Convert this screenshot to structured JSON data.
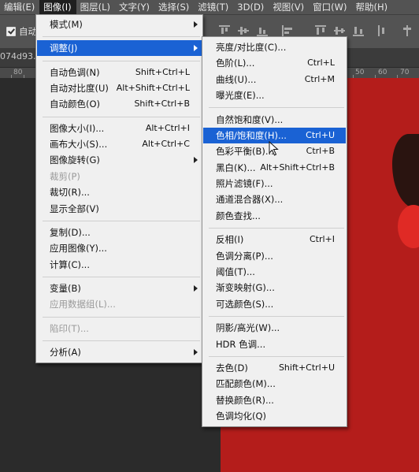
{
  "menubar": [
    {
      "label": "编辑(E)"
    },
    {
      "label": "图像(I)",
      "active": true
    },
    {
      "label": "图层(L)"
    },
    {
      "label": "文字(Y)"
    },
    {
      "label": "选择(S)"
    },
    {
      "label": "滤镜(T)"
    },
    {
      "label": "3D(D)"
    },
    {
      "label": "视图(V)"
    },
    {
      "label": "窗口(W)"
    },
    {
      "label": "帮助(H)"
    }
  ],
  "options_bar": {
    "auto_select_label": "自动"
  },
  "document_tab": {
    "title": "074d93.j"
  },
  "ruler": {
    "labels": [
      "80",
      "50",
      "60",
      "70"
    ]
  },
  "image_menu": [
    {
      "label": "模式(M)",
      "submenu": true
    },
    {
      "sep": true
    },
    {
      "label": "调整(J)",
      "submenu": true,
      "highlight": true
    },
    {
      "sep": true
    },
    {
      "label": "自动色调(N)",
      "shortcut": "Shift+Ctrl+L"
    },
    {
      "label": "自动对比度(U)",
      "shortcut": "Alt+Shift+Ctrl+L"
    },
    {
      "label": "自动颜色(O)",
      "shortcut": "Shift+Ctrl+B"
    },
    {
      "sep": true
    },
    {
      "label": "图像大小(I)...",
      "shortcut": "Alt+Ctrl+I"
    },
    {
      "label": "画布大小(S)...",
      "shortcut": "Alt+Ctrl+C"
    },
    {
      "label": "图像旋转(G)",
      "submenu": true
    },
    {
      "label": "裁剪(P)",
      "disabled": true
    },
    {
      "label": "裁切(R)..."
    },
    {
      "label": "显示全部(V)"
    },
    {
      "sep": true
    },
    {
      "label": "复制(D)..."
    },
    {
      "label": "应用图像(Y)..."
    },
    {
      "label": "计算(C)..."
    },
    {
      "sep": true
    },
    {
      "label": "变量(B)",
      "submenu": true
    },
    {
      "label": "应用数据组(L)...",
      "disabled": true
    },
    {
      "sep": true
    },
    {
      "label": "陷印(T)...",
      "disabled": true
    },
    {
      "sep": true
    },
    {
      "label": "分析(A)",
      "submenu": true
    }
  ],
  "adjust_menu": [
    {
      "label": "亮度/对比度(C)..."
    },
    {
      "label": "色阶(L)...",
      "shortcut": "Ctrl+L"
    },
    {
      "label": "曲线(U)...",
      "shortcut": "Ctrl+M"
    },
    {
      "label": "曝光度(E)..."
    },
    {
      "sep": true
    },
    {
      "label": "自然饱和度(V)..."
    },
    {
      "label": "色相/饱和度(H)...",
      "shortcut": "Ctrl+U",
      "highlight": true
    },
    {
      "label": "色彩平衡(B)...",
      "shortcut": "Ctrl+B"
    },
    {
      "label": "黑白(K)...",
      "shortcut": "Alt+Shift+Ctrl+B"
    },
    {
      "label": "照片滤镜(F)..."
    },
    {
      "label": "通道混合器(X)..."
    },
    {
      "label": "颜色查找..."
    },
    {
      "sep": true
    },
    {
      "label": "反相(I)",
      "shortcut": "Ctrl+I"
    },
    {
      "label": "色调分离(P)..."
    },
    {
      "label": "阈值(T)..."
    },
    {
      "label": "渐变映射(G)..."
    },
    {
      "label": "可选颜色(S)..."
    },
    {
      "sep": true
    },
    {
      "label": "阴影/高光(W)..."
    },
    {
      "label": "HDR 色调..."
    },
    {
      "sep": true
    },
    {
      "label": "去色(D)",
      "shortcut": "Shift+Ctrl+U"
    },
    {
      "label": "匹配颜色(M)..."
    },
    {
      "label": "替换颜色(R)..."
    },
    {
      "label": "色调均化(Q)"
    }
  ],
  "colors": {
    "highlight": "#1a62d4",
    "canvas": "#b41d1b",
    "menu_bg": "#f0f0f0"
  }
}
